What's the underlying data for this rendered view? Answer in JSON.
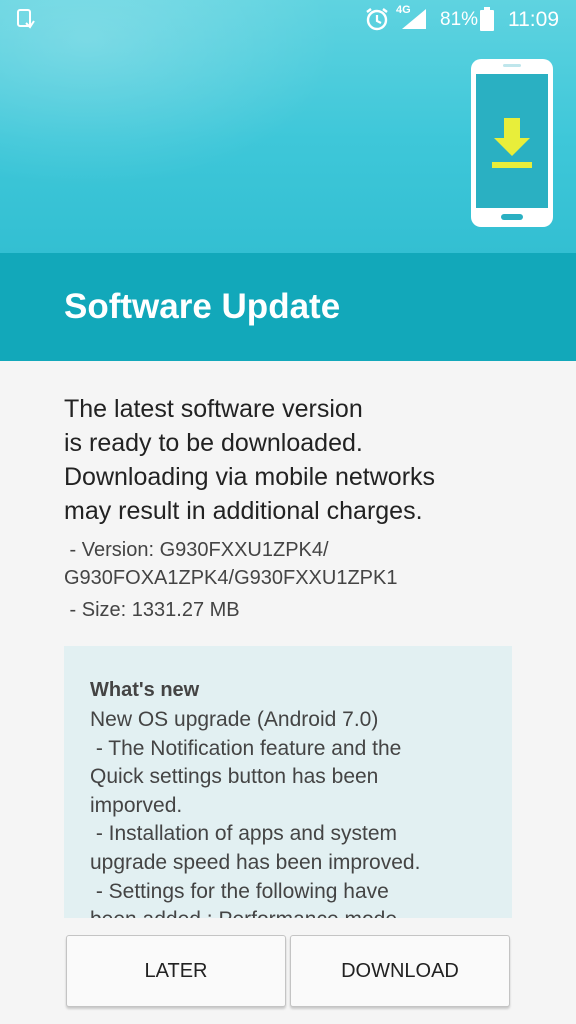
{
  "status_bar": {
    "network_type": "4G",
    "battery_percent": "81%",
    "time": "11:09",
    "icons": [
      "notification-icon",
      "alarm-icon",
      "signal-icon",
      "battery-icon"
    ]
  },
  "header": {
    "title": "Software Update",
    "illustration": "phone-download-icon",
    "colors": {
      "accent": "#12a8ba",
      "hero": "#3ec7d9",
      "arrow": "#e8ee3a"
    }
  },
  "main": {
    "message_lines": [
      "The latest software version",
      "is ready to be downloaded.",
      "Downloading via mobile networks",
      "may result in additional charges."
    ],
    "version_lines": [
      " - Version: G930FXXU1ZPK4/",
      "G930FOXA1ZPK4/G930FXXU1ZPK1"
    ],
    "size_text": " - Size: 1331.27 MB"
  },
  "whats_new": {
    "heading": "What's new",
    "lines": [
      "New OS upgrade (Android 7.0)",
      " - The Notification feature and the",
      "Quick settings button has been",
      "imporved.",
      " - Installation of apps and system",
      "upgrade speed has been improved.",
      " - Settings for the following have",
      "been added : Performance mode"
    ]
  },
  "actions": {
    "later_label": "LATER",
    "download_label": "DOWNLOAD"
  }
}
